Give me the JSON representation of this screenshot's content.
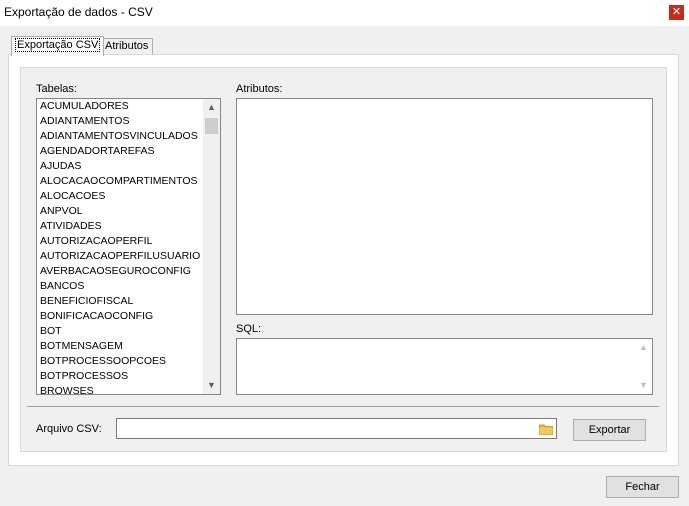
{
  "window": {
    "title": "Exportação de dados - CSV",
    "close_glyph": "✕"
  },
  "tabs": [
    {
      "label": "Exportação CSV",
      "active": true
    },
    {
      "label": "Atributos",
      "active": false
    }
  ],
  "tables": {
    "label": "Tabelas:",
    "items": [
      "ACUMULADORES",
      "ADIANTAMENTOS",
      "ADIANTAMENTOSVINCULADOS",
      "AGENDADORTAREFAS",
      "AJUDAS",
      "ALOCACAOCOMPARTIMENTOS",
      "ALOCACOES",
      "ANPVOL",
      "ATIVIDADES",
      "AUTORIZACAOPERFIL",
      "AUTORIZACAOPERFILUSUARIO",
      "AVERBACAOSEGUROCONFIG",
      "BANCOS",
      "BENEFICIOFISCAL",
      "BONIFICACAOCONFIG",
      "BOT",
      "BOTMENSAGEM",
      "BOTPROCESSOOPCOES",
      "BOTPROCESSOS",
      "BROWSES"
    ]
  },
  "attributes": {
    "label": "Atributos:"
  },
  "sql": {
    "label": "SQL:"
  },
  "csv_file": {
    "label": "Arquivo CSV:",
    "value": "",
    "icon": "folder-icon"
  },
  "buttons": {
    "export": "Exportar",
    "close": "Fechar"
  },
  "scroll": {
    "up": "▲",
    "down": "▼"
  }
}
